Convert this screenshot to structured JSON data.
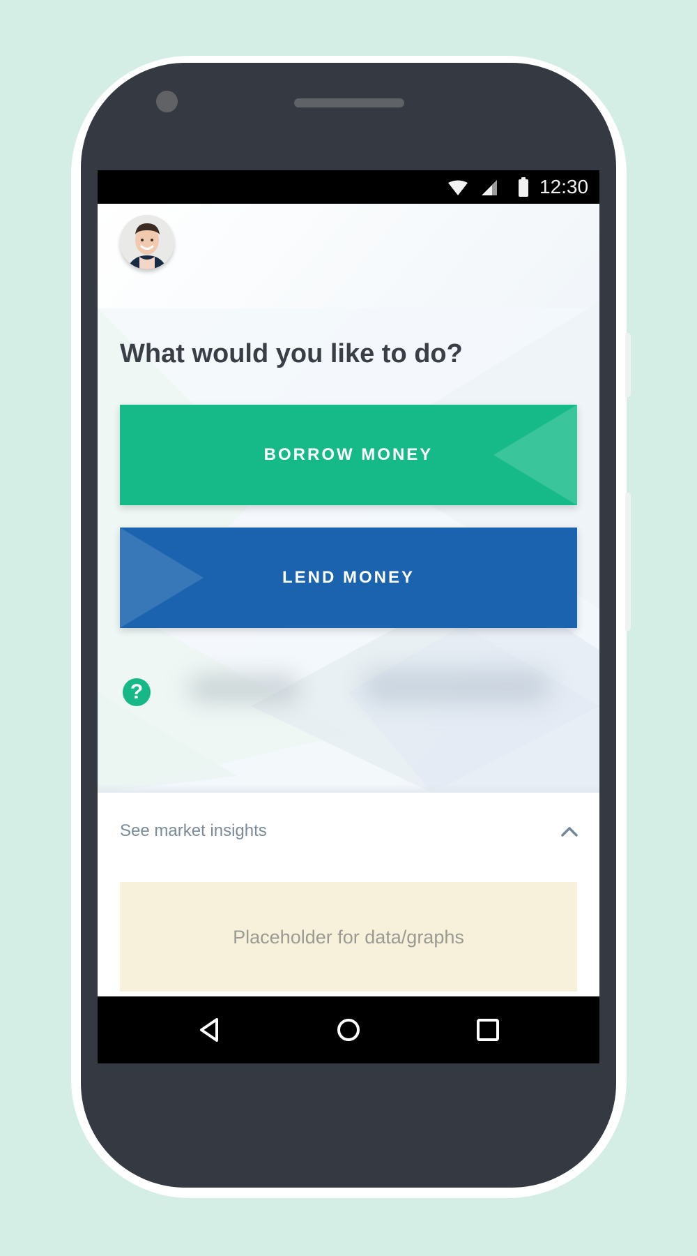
{
  "status_bar": {
    "time": "12:30",
    "icons": [
      "wifi-icon",
      "cellular-signal-icon",
      "battery-icon"
    ]
  },
  "profile": {
    "avatar_icon": "user-avatar"
  },
  "main": {
    "question": "What would you like to do?",
    "borrow_label": "BORROW MONEY",
    "lend_label": "LEND MONEY",
    "help_icon": "question-mark-icon"
  },
  "insights": {
    "toggle_label": "See market insights",
    "toggle_icon": "chevron-up-icon",
    "placeholder_text": "Placeholder for data/graphs"
  },
  "navigation": {
    "back_icon": "back-triangle-icon",
    "home_icon": "home-circle-icon",
    "recent_icon": "recent-apps-square-icon"
  },
  "colors": {
    "page_background": "#d4eee5",
    "phone_body": "#353a42",
    "borrow_button": "#16ba88",
    "lend_button": "#1b63ae",
    "help_icon": "#17b887",
    "question_text": "#3a3f47",
    "insights_text": "#7b8a99",
    "placeholder_background": "#f7f1dc",
    "placeholder_text": "#9a9a92"
  }
}
